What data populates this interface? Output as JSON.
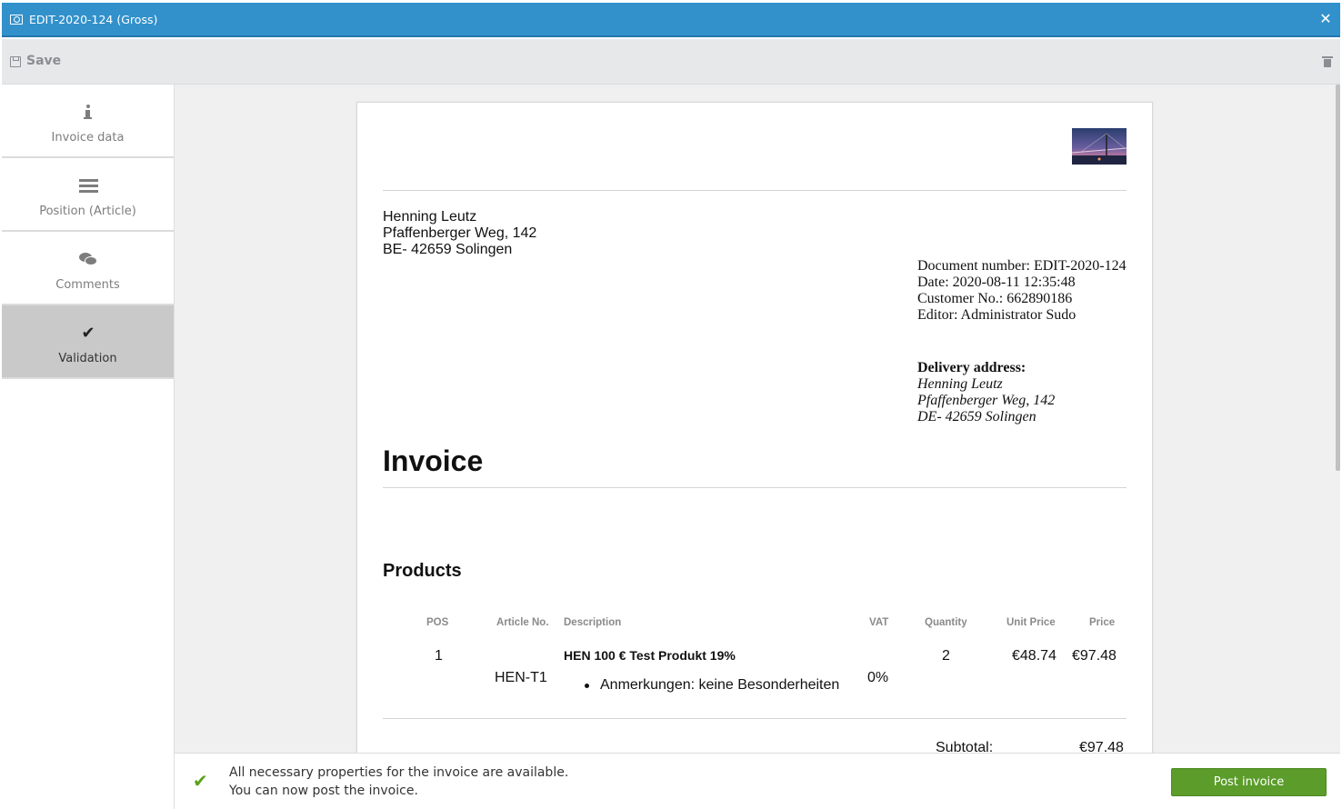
{
  "window": {
    "title": "EDIT-2020-124 (Gross)",
    "close_glyph": "✕"
  },
  "toolbar": {
    "save_label": "Save"
  },
  "sidebar": {
    "items": [
      {
        "label": "Invoice data",
        "icon": "info-icon"
      },
      {
        "label": "Position (Article)",
        "icon": "list-icon"
      },
      {
        "label": "Comments",
        "icon": "comments-icon"
      },
      {
        "label": "Validation",
        "icon": "check-icon",
        "active": true
      }
    ]
  },
  "document": {
    "customer_address": [
      "Henning Leutz",
      "Pfaffenberger Weg, 142",
      "BE- 42659 Solingen"
    ],
    "meta": {
      "document_number": "Document number: EDIT-2020-124",
      "date": "Date: 2020-08-11 12:35:48",
      "customer_no": "Customer No.: 662890186",
      "editor": "Editor: Administrator Sudo"
    },
    "delivery": {
      "heading": "Delivery address:",
      "lines": [
        "Henning Leutz",
        "Pfaffenberger Weg, 142",
        "DE- 42659 Solingen"
      ]
    },
    "heading": "Invoice",
    "products_heading": "Products",
    "table": {
      "headers": [
        "POS",
        "Article No.",
        "Description",
        "VAT",
        "Quantity",
        "Unit Price",
        "Price"
      ],
      "rows": [
        {
          "pos": "1",
          "article_no": "HEN-T1",
          "title": "HEN 100 € Test Produkt 19%",
          "note": "Anmerkungen: keine Besonderheiten",
          "vat": "0%",
          "quantity": "2",
          "unit_price": "€48.74",
          "price": "€97.48"
        }
      ]
    },
    "subtotal_label": "Subtotal:",
    "subtotal_value": "€97.48"
  },
  "footer": {
    "message_line1": "All necessary properties for the invoice are available.",
    "message_line2": "You can now post the invoice.",
    "check_glyph": "✔",
    "post_button": "Post invoice"
  },
  "colors": {
    "titlebar": "#3291cb",
    "post_button": "#5b9c2a",
    "success_check": "#5aa21c",
    "active_nav": "#c9c9c9"
  }
}
